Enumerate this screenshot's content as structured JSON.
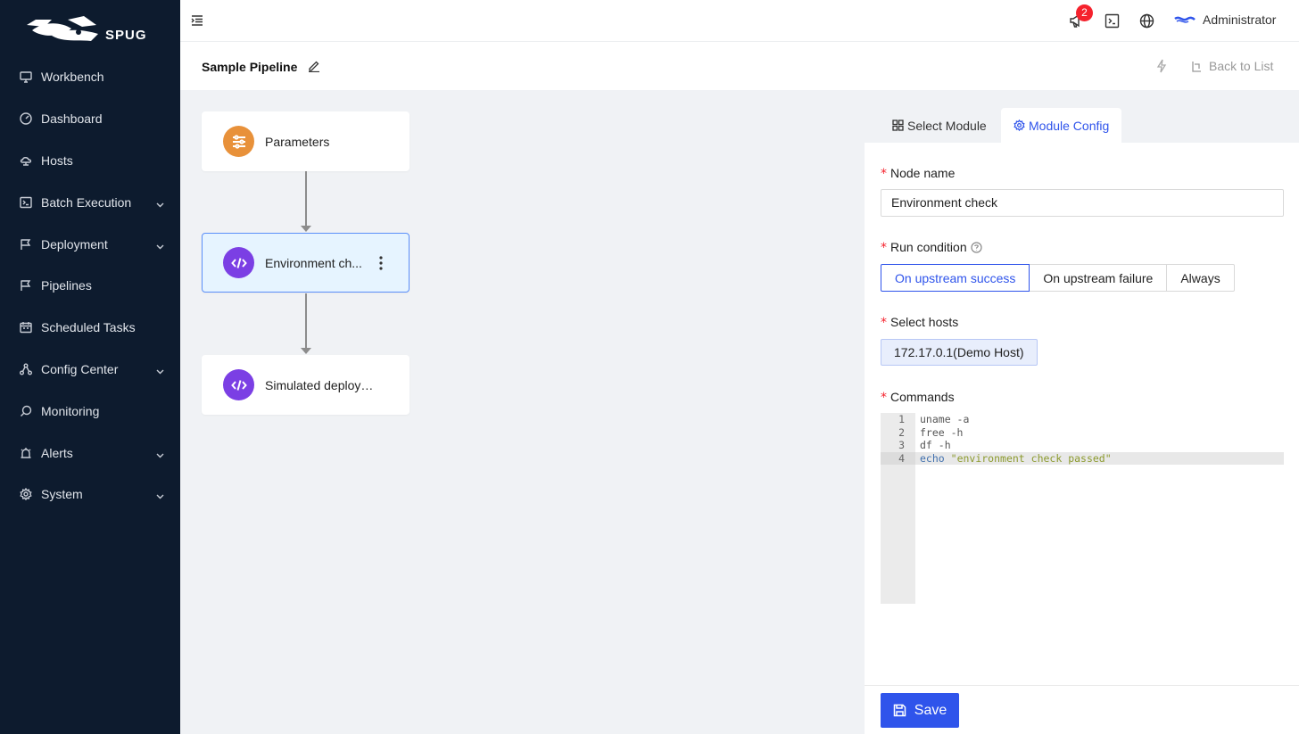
{
  "app": {
    "logo_text": "SPUG",
    "brand_color": "#0d1b2e",
    "accent_color": "#2f54eb"
  },
  "sidebar": {
    "items": [
      {
        "label": "Workbench",
        "icon": "monitor-icon",
        "expandable": false
      },
      {
        "label": "Dashboard",
        "icon": "dashboard-icon",
        "expandable": false
      },
      {
        "label": "Hosts",
        "icon": "cloud-server-icon",
        "expandable": false
      },
      {
        "label": "Batch Execution",
        "icon": "terminal-icon",
        "expandable": true
      },
      {
        "label": "Deployment",
        "icon": "flag-icon",
        "expandable": true
      },
      {
        "label": "Pipelines",
        "icon": "flag-icon",
        "expandable": false
      },
      {
        "label": "Scheduled Tasks",
        "icon": "calendar-icon",
        "expandable": false
      },
      {
        "label": "Config Center",
        "icon": "cluster-icon",
        "expandable": true
      },
      {
        "label": "Monitoring",
        "icon": "monitor-search-icon",
        "expandable": false
      },
      {
        "label": "Alerts",
        "icon": "alarm-icon",
        "expandable": true
      },
      {
        "label": "System",
        "icon": "gear-icon",
        "expandable": true
      }
    ]
  },
  "header": {
    "notification_count": "2",
    "user_name": "Administrator"
  },
  "page": {
    "title": "Sample Pipeline",
    "back_label": "Back to List"
  },
  "pipeline": {
    "nodes": [
      {
        "label": "Parameters",
        "icon": "sliders-icon",
        "color": "#e8913a"
      },
      {
        "label": "Environment ch...",
        "icon": "code-icon",
        "color": "#7b3fe4",
        "active": true
      },
      {
        "label": "Simulated deploym...",
        "icon": "code-icon",
        "color": "#7b3fe4"
      }
    ]
  },
  "panel": {
    "tabs": [
      {
        "label": "Select Module",
        "icon": "appstore-icon"
      },
      {
        "label": "Module Config",
        "icon": "gear-icon",
        "active": true
      }
    ],
    "node_name_label": "Node name",
    "node_name_value": "Environment check",
    "run_condition_label": "Run condition",
    "run_condition_options": [
      "On upstream success",
      "On upstream failure",
      "Always"
    ],
    "run_condition_selected": "On upstream success",
    "hosts_label": "Select hosts",
    "selected_host": "172.17.0.1(Demo Host)",
    "commands_label": "Commands",
    "commands": [
      {
        "no": "1",
        "text": "uname -a"
      },
      {
        "no": "2",
        "text": "free -h"
      },
      {
        "no": "3",
        "text": "df -h"
      },
      {
        "no": "4",
        "keyword": "echo",
        "string": "\"environment check passed\""
      }
    ],
    "save_label": "Save"
  }
}
